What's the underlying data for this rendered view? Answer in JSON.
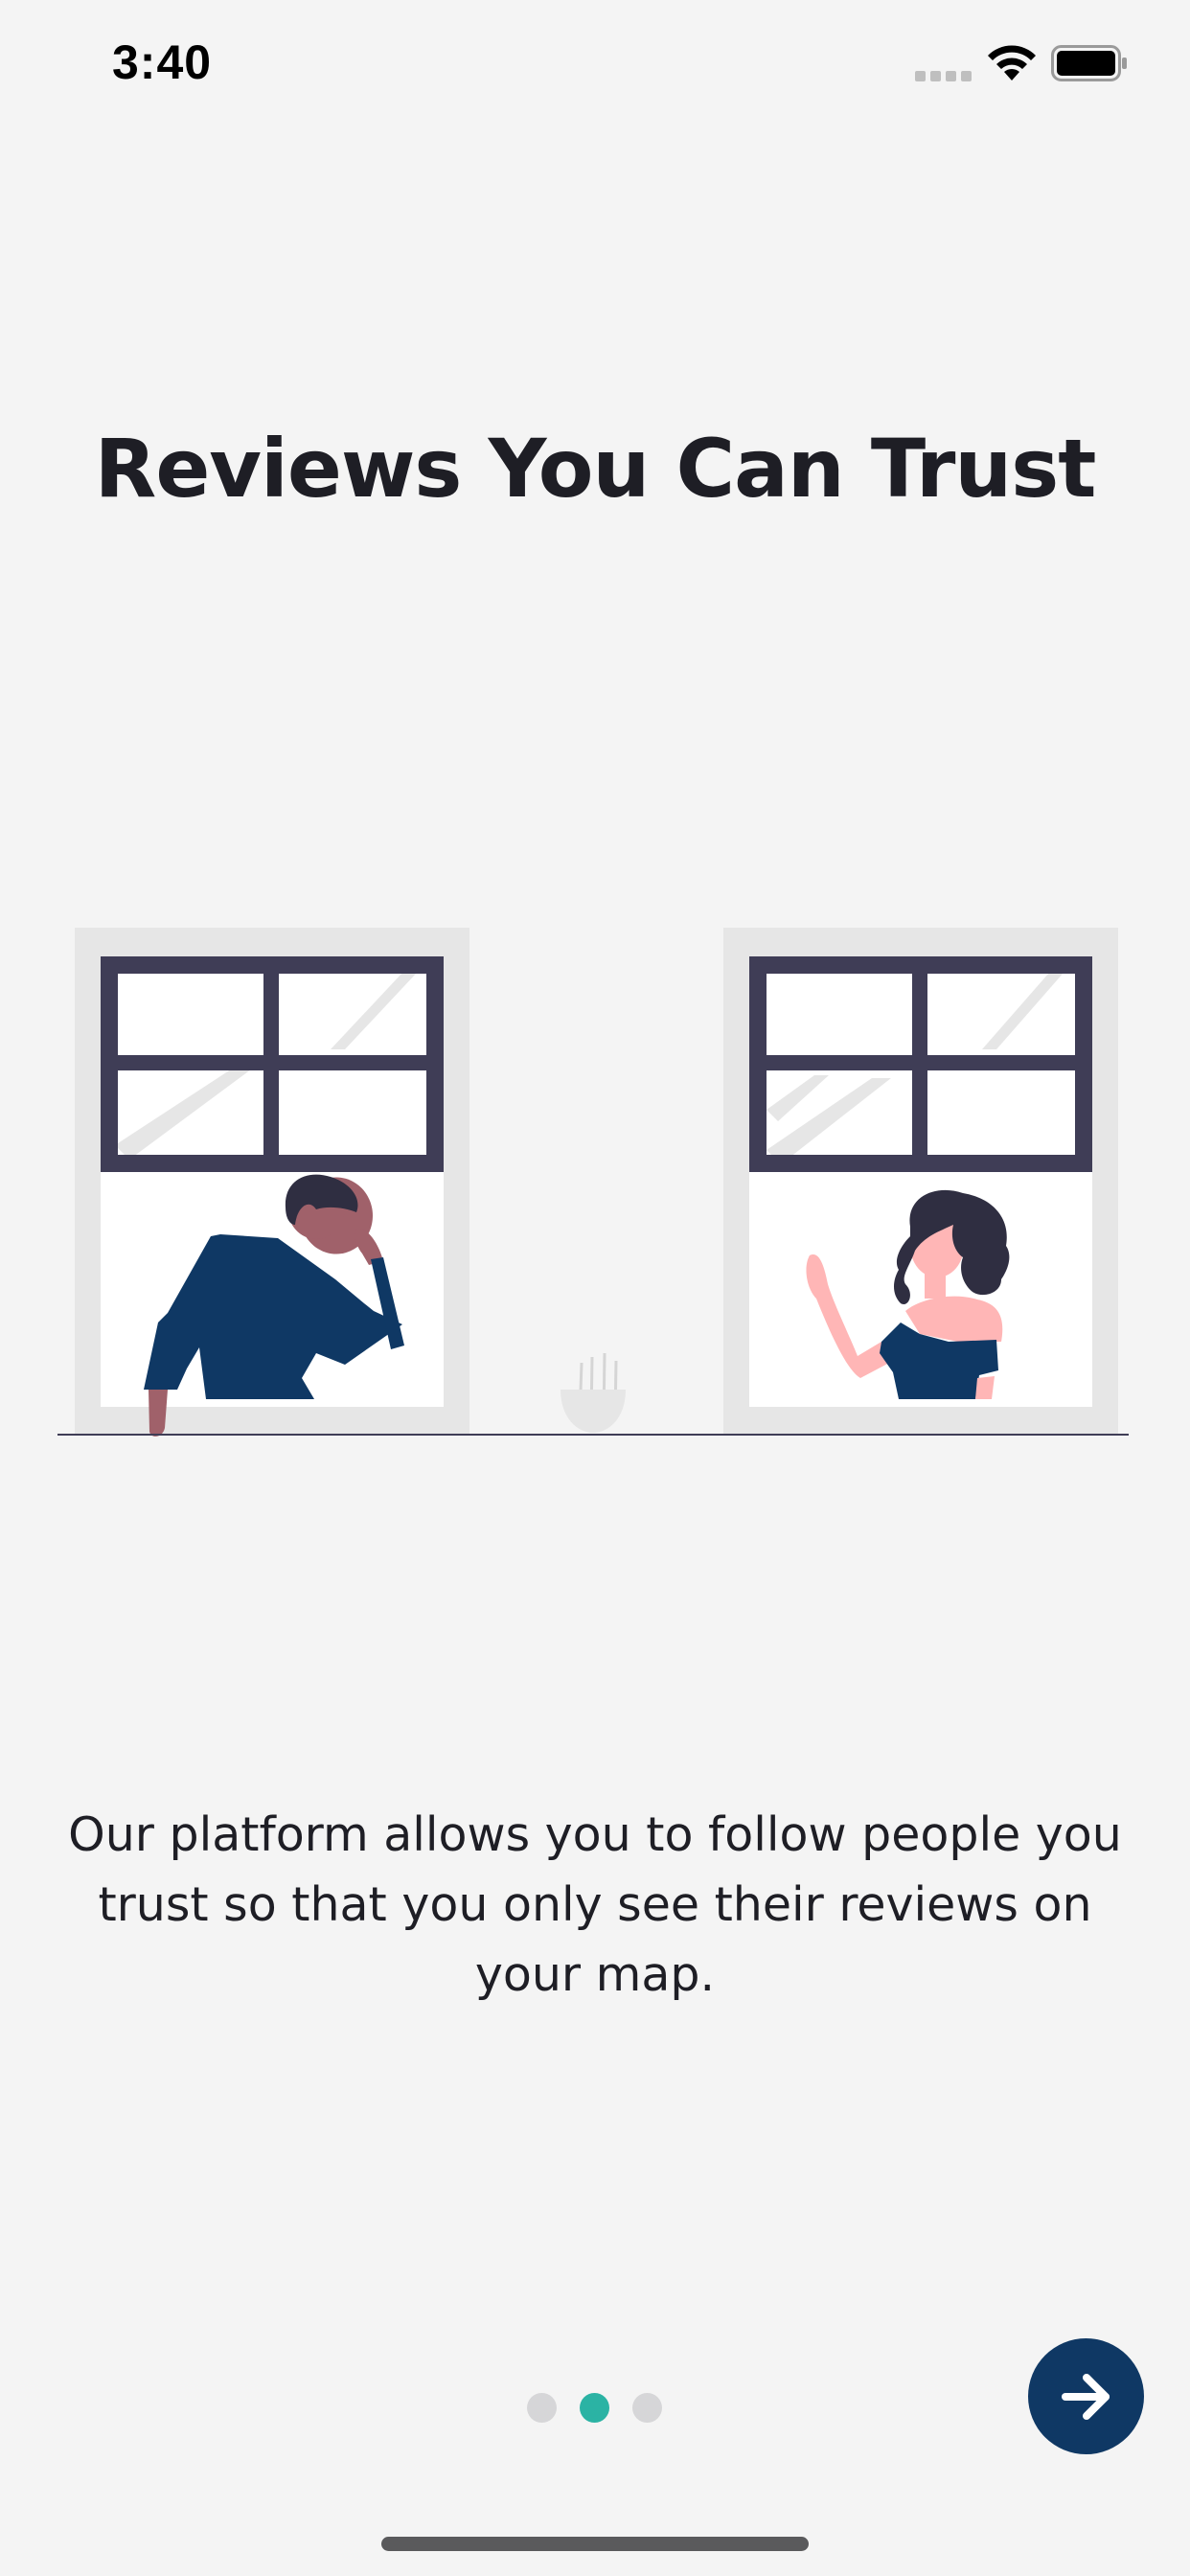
{
  "status_bar": {
    "time": "3:40",
    "icons": [
      "cellular-signal-icon",
      "wifi-icon",
      "battery-icon"
    ]
  },
  "onboarding": {
    "title": "Reviews You Can Trust",
    "description": "Our platform allows you to follow people you trust so that you only see their reviews on your map.",
    "illustration": "two-people-waving-from-windows-illustration",
    "pager": {
      "total_pages": 3,
      "current_page": 2
    },
    "next_button_icon": "arrow-right-icon"
  },
  "colors": {
    "background": "#f4f4f4",
    "accent_teal": "#2bb3a4",
    "navy": "#0f3864",
    "window_frame": "#3f3d56",
    "dot_inactive": "#d6d6d8"
  }
}
